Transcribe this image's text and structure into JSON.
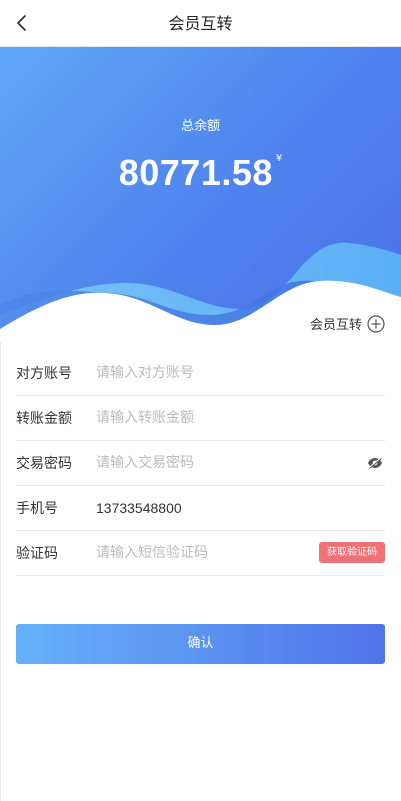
{
  "nav": {
    "title": "会员互转"
  },
  "hero": {
    "balance_label": "总余额",
    "balance": "80771.58",
    "unit": "¥",
    "member_transfer_label": "会员互转"
  },
  "form": {
    "fields": [
      {
        "label": "对方账号",
        "placeholder": "请输入对方账号"
      },
      {
        "label": "转账金额",
        "placeholder": "请输入转账金额"
      },
      {
        "label": "交易密码",
        "placeholder": "请输入交易密码"
      },
      {
        "label": "手机号",
        "value": "13733548800"
      },
      {
        "label": "验证码",
        "placeholder": "请输入短信验证码",
        "button": "获取验证码"
      }
    ]
  },
  "confirm_label": "确认",
  "colors": {
    "gradient_start": "#5fa8f7",
    "gradient_end": "#4b6fe8",
    "code_button": "#f07174"
  }
}
